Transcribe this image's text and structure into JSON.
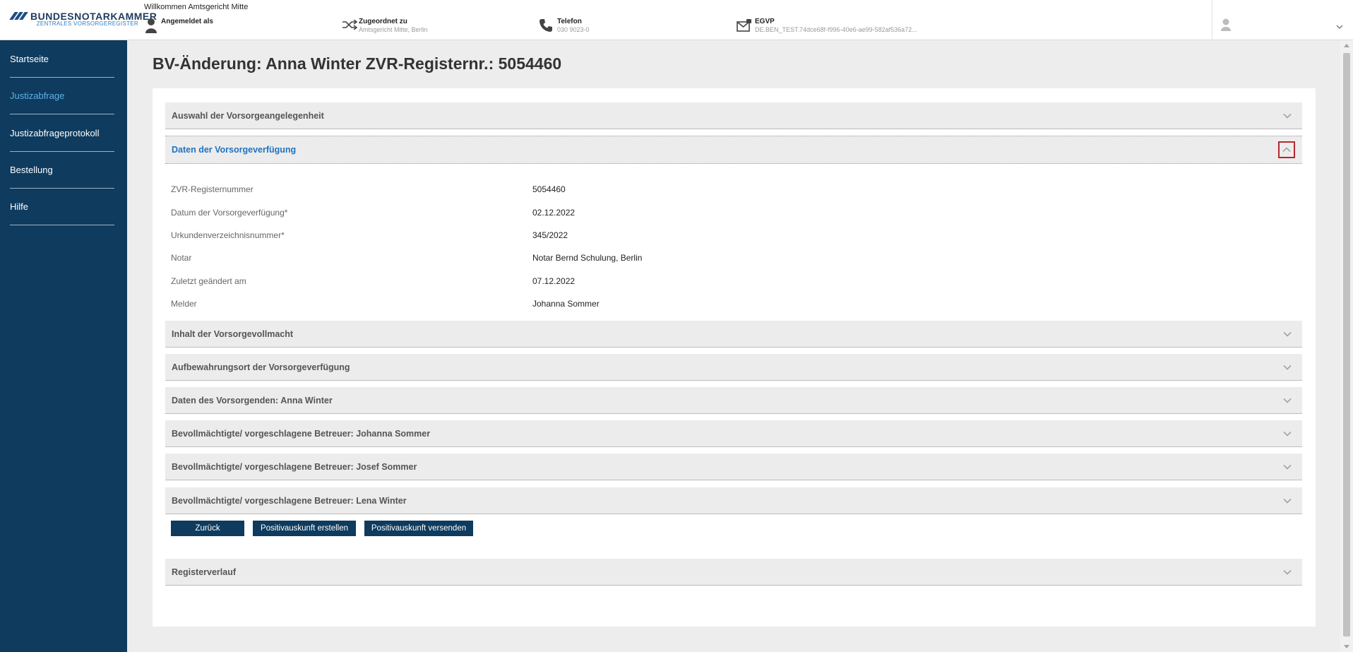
{
  "header": {
    "logo_name": "BUNDESNOTARKAMMER",
    "logo_sub": "ZENTRALES VORSORGEREGISTER",
    "welcome": "Willkommen Amtsgericht Mitte",
    "logged_in_label": "Angemeldet als",
    "assigned_label": "Zugeordnet zu",
    "assigned_value": "Amtsgericht Mitte, Berlin",
    "phone_label": "Telefon",
    "phone_value": "030 9023-0",
    "egvp_label": "EGVP",
    "egvp_value": "DE.BEN_TEST.74dce68f-f996-40e6-ae99-582af536a72..."
  },
  "sidebar": {
    "items": [
      {
        "label": "Startseite",
        "active": false
      },
      {
        "label": "Justizabfrage",
        "active": true
      },
      {
        "label": "Justizabfrageprotokoll",
        "active": false
      },
      {
        "label": "Bestellung",
        "active": false
      },
      {
        "label": "Hilfe",
        "active": false
      }
    ]
  },
  "main": {
    "title": "BV-Änderung: Anna Winter ZVR-Registernr.: 5054460",
    "sections": [
      {
        "label": "Auswahl der Vorsorgeangelegenheit",
        "open": false
      },
      {
        "label": "Daten der Vorsorgeverfügung",
        "open": true
      },
      {
        "label": "Inhalt der Vorsorgevollmacht",
        "open": false
      },
      {
        "label": "Aufbewahrungsort der Vorsorgeverfügung",
        "open": false
      },
      {
        "label": "Daten des Vorsorgenden: Anna Winter",
        "open": false
      },
      {
        "label": "Bevollmächtigte/ vorgeschlagene Betreuer: Johanna Sommer",
        "open": false
      },
      {
        "label": "Bevollmächtigte/ vorgeschlagene Betreuer: Josef Sommer",
        "open": false
      },
      {
        "label": "Bevollmächtigte/ vorgeschlagene Betreuer: Lena Winter",
        "open": false
      },
      {
        "label": "Registerverlauf",
        "open": false
      }
    ],
    "details": [
      {
        "label": "ZVR-Registernummer",
        "value": "5054460"
      },
      {
        "label": "Datum der Vorsorgeverfügung*",
        "value": "02.12.2022"
      },
      {
        "label": "Urkundenverzeichnisnummer*",
        "value": "345/2022"
      },
      {
        "label": "Notar",
        "value": "Notar Bernd Schulung, Berlin"
      },
      {
        "label": "Zuletzt geändert am",
        "value": "07.12.2022"
      },
      {
        "label": "Melder",
        "value": "Johanna Sommer"
      }
    ],
    "buttons": {
      "back": "Zurück",
      "create": "Positivauskunft erstellen",
      "send": "Positivauskunft versenden"
    }
  },
  "colors": {
    "sidebar_bg": "#0e3b5e",
    "accent_blue": "#1f73c1",
    "active_nav": "#5fb0e8",
    "focus_red": "#b8262d"
  }
}
